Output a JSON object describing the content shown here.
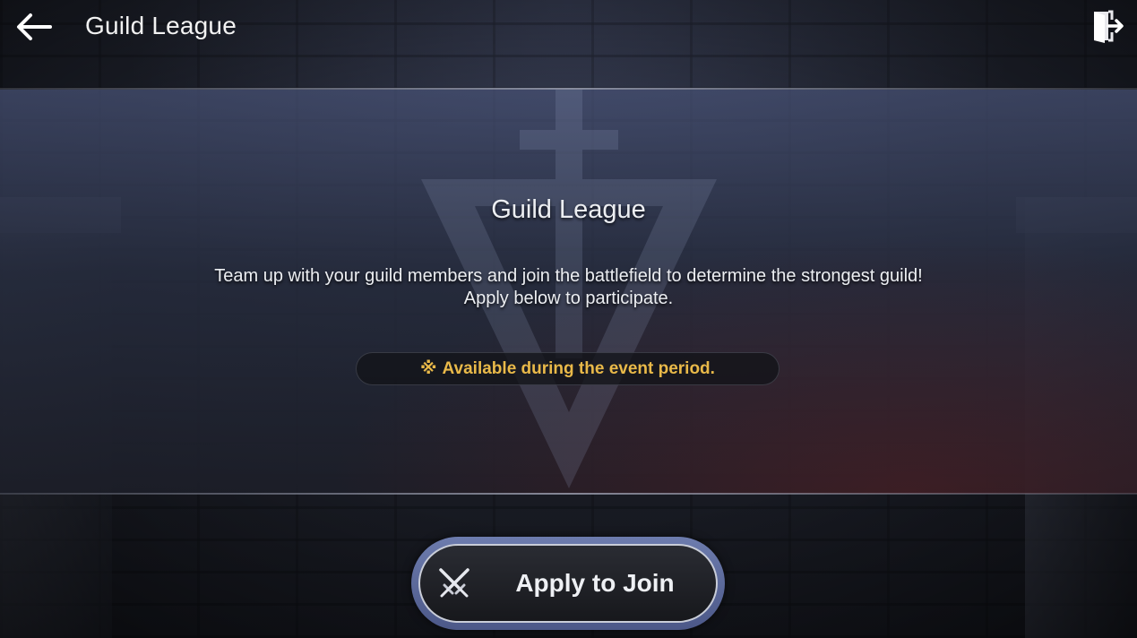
{
  "header": {
    "title": "Guild League"
  },
  "panel": {
    "title": "Guild League",
    "description_line1": "Team up with your guild members and join the battlefield to determine the strongest guild!",
    "description_line2": "Apply below to participate.",
    "notice_mark": "※",
    "notice_text": "Available during the event period."
  },
  "actions": {
    "apply_label": "Apply to Join"
  },
  "icons": {
    "back": "back-arrow-icon",
    "exit": "exit-door-icon",
    "apply": "crossed-swords-icon"
  },
  "colors": {
    "notice_text": "#e9b949",
    "button_ring": "#5d6a9c",
    "text_primary": "#eceef2"
  }
}
